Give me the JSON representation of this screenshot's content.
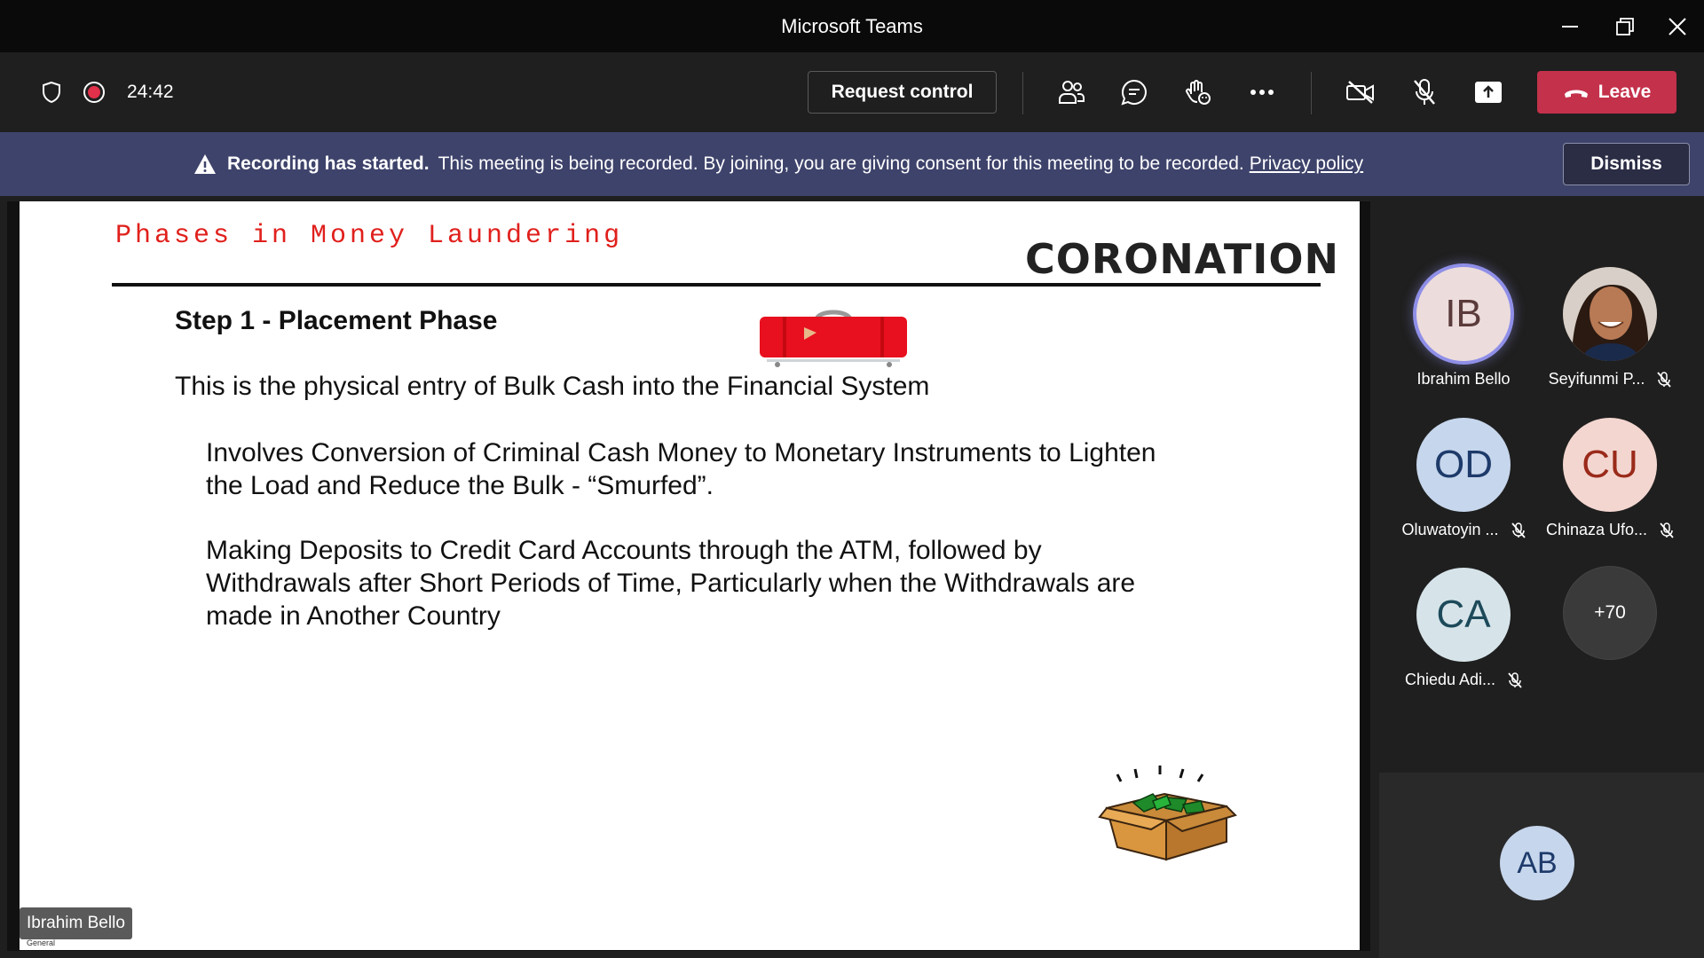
{
  "window": {
    "title": "Microsoft Teams"
  },
  "toolbar": {
    "timer": "24:42",
    "request_control": "Request control",
    "leave": "Leave"
  },
  "banner": {
    "bold": "Recording has started.",
    "text": "This meeting is being recorded. By joining, you are giving consent for this meeting to be recorded.",
    "link": "Privacy policy",
    "dismiss": "Dismiss"
  },
  "slide": {
    "heading": "Phases in Money Laundering",
    "brand": "CORONATION",
    "step": "Step 1 - Placement Phase",
    "intro": "This is the physical entry of Bulk Cash into the Financial System",
    "bullets": [
      "Involves Conversion of Criminal Cash Money to Monetary Instruments to Lighten the Load and Reduce the Bulk - “Smurfed”.",
      "Making Deposits to Credit Card Accounts through the ATM, followed by Withdrawals after Short Periods of Time, Particularly when the Withdrawals are made in Another Country"
    ]
  },
  "presenter": {
    "name": "Ibrahim Bello",
    "sublabel": "General"
  },
  "participants": [
    {
      "initials": "IB",
      "name": "Ibrahim Bello",
      "bg": "#ecdcdc",
      "fg": "#5a3a3a",
      "muted": false,
      "speaking": true
    },
    {
      "initials": "",
      "name": "Seyifunmi P...",
      "bg": "#6b4a3a",
      "fg": "#fff",
      "muted": true,
      "photo": true
    },
    {
      "initials": "OD",
      "name": "Oluwatoyin ...",
      "bg": "#c6d6ec",
      "fg": "#1d3a6a",
      "muted": true
    },
    {
      "initials": "CU",
      "name": "Chinaza Ufo...",
      "bg": "#f3d6d0",
      "fg": "#9a2a1a",
      "muted": true
    },
    {
      "initials": "CA",
      "name": "Chiedu Adi...",
      "bg": "#d6e4ea",
      "fg": "#1d4a5a",
      "muted": true
    },
    {
      "initials": "+70",
      "name": "",
      "bg": "#3a3a3a",
      "fg": "#fff",
      "muted": false
    }
  ],
  "self": {
    "initials": "AB"
  }
}
